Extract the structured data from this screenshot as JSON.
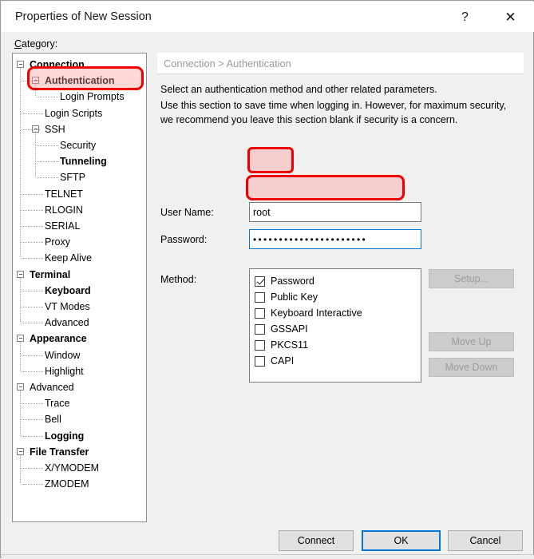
{
  "window": {
    "title": "Properties of New Session",
    "help_icon": "question-mark-icon",
    "close_icon": "close-icon"
  },
  "category": {
    "label_prefix": "C",
    "label_rest": "ategory:",
    "items": [
      {
        "label": "Connection",
        "level": 0,
        "bold": true,
        "expander": true
      },
      {
        "label": "Authentication",
        "level": 1,
        "bold": true,
        "expander": true
      },
      {
        "label": "Login Prompts",
        "level": 2,
        "bold": false,
        "expander": false
      },
      {
        "label": "Login Scripts",
        "level": 1,
        "bold": false,
        "expander": false
      },
      {
        "label": "SSH",
        "level": 1,
        "bold": false,
        "expander": true
      },
      {
        "label": "Security",
        "level": 2,
        "bold": false,
        "expander": false
      },
      {
        "label": "Tunneling",
        "level": 2,
        "bold": true,
        "expander": false
      },
      {
        "label": "SFTP",
        "level": 2,
        "bold": false,
        "expander": false
      },
      {
        "label": "TELNET",
        "level": 1,
        "bold": false,
        "expander": false
      },
      {
        "label": "RLOGIN",
        "level": 1,
        "bold": false,
        "expander": false
      },
      {
        "label": "SERIAL",
        "level": 1,
        "bold": false,
        "expander": false
      },
      {
        "label": "Proxy",
        "level": 1,
        "bold": false,
        "expander": false
      },
      {
        "label": "Keep Alive",
        "level": 1,
        "bold": false,
        "expander": false
      },
      {
        "label": "Terminal",
        "level": 0,
        "bold": true,
        "expander": true
      },
      {
        "label": "Keyboard",
        "level": 1,
        "bold": true,
        "expander": false
      },
      {
        "label": "VT Modes",
        "level": 1,
        "bold": false,
        "expander": false
      },
      {
        "label": "Advanced",
        "level": 1,
        "bold": false,
        "expander": false
      },
      {
        "label": "Appearance",
        "level": 0,
        "bold": true,
        "expander": true
      },
      {
        "label": "Window",
        "level": 1,
        "bold": false,
        "expander": false
      },
      {
        "label": "Highlight",
        "level": 1,
        "bold": false,
        "expander": false
      },
      {
        "label": "Advanced",
        "level": 0,
        "bold": false,
        "expander": true
      },
      {
        "label": "Trace",
        "level": 1,
        "bold": false,
        "expander": false
      },
      {
        "label": "Bell",
        "level": 1,
        "bold": false,
        "expander": false
      },
      {
        "label": "Logging",
        "level": 1,
        "bold": true,
        "expander": false
      },
      {
        "label": "File Transfer",
        "level": 0,
        "bold": true,
        "expander": true
      },
      {
        "label": "X/YMODEM",
        "level": 1,
        "bold": false,
        "expander": false
      },
      {
        "label": "ZMODEM",
        "level": 1,
        "bold": false,
        "expander": false
      }
    ],
    "selected": "Authentication"
  },
  "panel": {
    "breadcrumb": "Connection > Authentication",
    "description_line1": "Select an authentication method and other related parameters.",
    "description_line2": "Use this section to save time when logging in. However, for maximum security, we recommend you leave this section blank if security is a concern.",
    "username_label": "User Name:",
    "username_value": "root",
    "password_label": "Password:",
    "password_value": "••••••••••••••••••••••",
    "method_label": "Method:",
    "methods": [
      {
        "label": "Password",
        "checked": true
      },
      {
        "label": "Public Key",
        "checked": false
      },
      {
        "label": "Keyboard Interactive",
        "checked": false
      },
      {
        "label": "GSSAPI",
        "checked": false
      },
      {
        "label": "PKCS11",
        "checked": false
      },
      {
        "label": "CAPI",
        "checked": false
      }
    ],
    "setup_button": "Setup...",
    "move_up_button": "Move Up",
    "move_down_button": "Move Down"
  },
  "footer": {
    "connect_button": "Connect",
    "ok_button": "OK",
    "cancel_button": "Cancel"
  },
  "annotations": {
    "colors": {
      "stroke": "#ee0000",
      "fill": "#ff9696"
    },
    "targets": [
      "Authentication",
      "User Name field",
      "Password field"
    ]
  }
}
